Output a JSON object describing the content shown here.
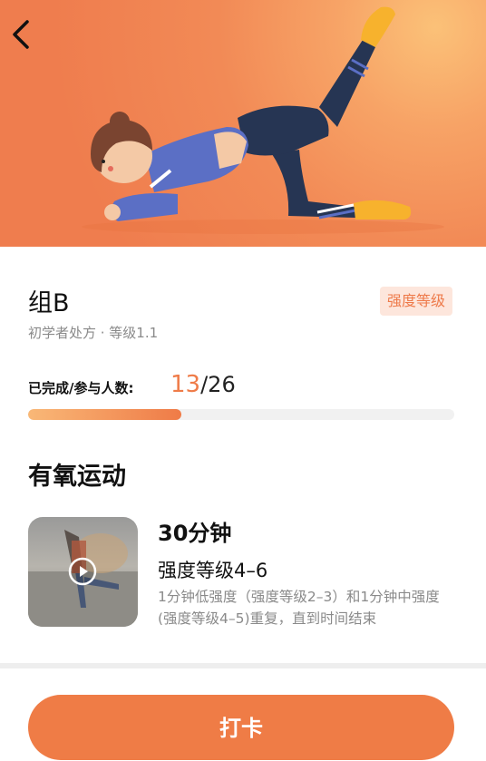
{
  "header": {
    "back_icon": "chevron-left-icon"
  },
  "workout": {
    "group_title": "组B",
    "intensity_badge": "强度等级",
    "subtitle": "初学者处方 · 等级1.1"
  },
  "progress": {
    "label": "已完成/参与人数:",
    "completed": "13",
    "total": "/26",
    "fraction": 0.36
  },
  "section": {
    "heading": "有氧运动"
  },
  "exercise": {
    "duration": "30分钟",
    "intensity": "强度等级4–6",
    "description": "1分钟低强度（强度等级2–3）和1分钟中强度(强度等级4–5)重复，直到时间结束",
    "video_icon": "play-icon"
  },
  "actions": {
    "checkin_label": "打卡"
  },
  "colors": {
    "accent": "#ef7c46",
    "badge_bg": "#fde6dc",
    "progress_start": "#f9b877"
  }
}
